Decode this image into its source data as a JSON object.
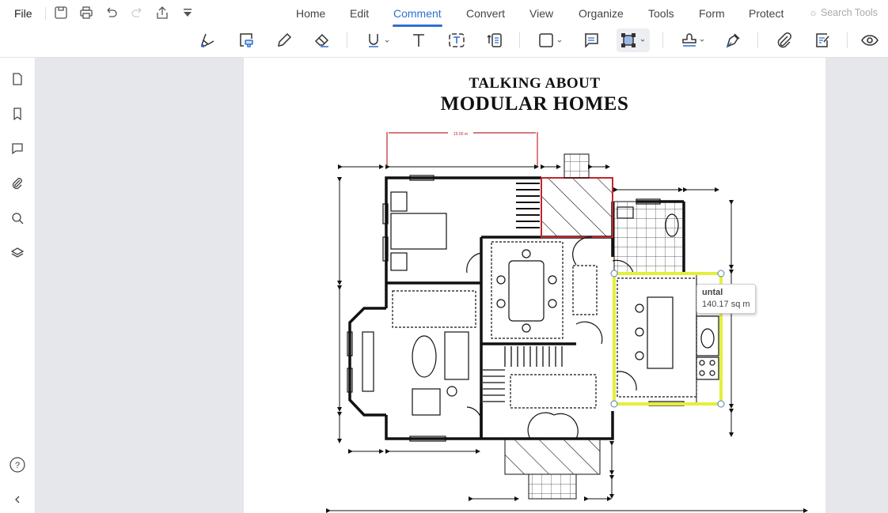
{
  "menubar": {
    "file": "File",
    "tabs": [
      "Home",
      "Edit",
      "Comment",
      "Convert",
      "View",
      "Organize",
      "Tools",
      "Form",
      "Protect"
    ],
    "active": "Comment",
    "search": "Search Tools"
  },
  "toolbar": {
    "tools": [
      "highlight",
      "area-highlight",
      "pencil",
      "eraser",
      "underline",
      "text",
      "text-box",
      "callout",
      "rectangle",
      "note",
      "area-measure",
      "stamp",
      "signature",
      "attachment",
      "edit-comments",
      "hide-comments"
    ],
    "selected": "area-measure"
  },
  "sidebar": {
    "icons": [
      "page",
      "bookmark",
      "comment",
      "attachment",
      "search",
      "layers"
    ],
    "bottom": [
      "help",
      "collapse"
    ]
  },
  "document": {
    "title_line1": "TALKING ABOUT",
    "title_line2": "MODULAR HOMES",
    "dimension_label": "15.00 m"
  },
  "tooltip": {
    "title": "untal",
    "value": "140.17 sq m"
  },
  "colors": {
    "accent": "#2f6fd0",
    "measure_highlight": "#e4ef3a",
    "red_annotation": "#c0272d"
  }
}
